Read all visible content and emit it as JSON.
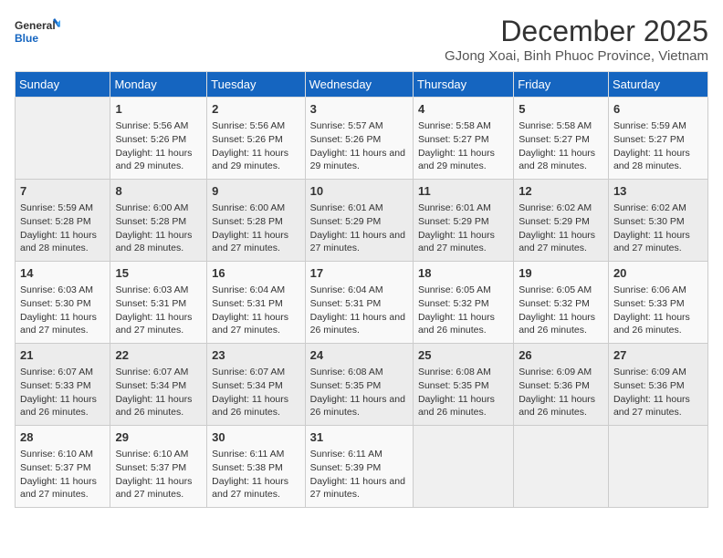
{
  "logo": {
    "line1": "General",
    "line2": "Blue"
  },
  "title": "December 2025",
  "location": "GJong Xoai, Binh Phuoc Province, Vietnam",
  "headers": [
    "Sunday",
    "Monday",
    "Tuesday",
    "Wednesday",
    "Thursday",
    "Friday",
    "Saturday"
  ],
  "weeks": [
    [
      {
        "day": "",
        "info": ""
      },
      {
        "day": "1",
        "info": "Sunrise: 5:56 AM\nSunset: 5:26 PM\nDaylight: 11 hours and 29 minutes."
      },
      {
        "day": "2",
        "info": "Sunrise: 5:56 AM\nSunset: 5:26 PM\nDaylight: 11 hours and 29 minutes."
      },
      {
        "day": "3",
        "info": "Sunrise: 5:57 AM\nSunset: 5:26 PM\nDaylight: 11 hours and 29 minutes."
      },
      {
        "day": "4",
        "info": "Sunrise: 5:58 AM\nSunset: 5:27 PM\nDaylight: 11 hours and 29 minutes."
      },
      {
        "day": "5",
        "info": "Sunrise: 5:58 AM\nSunset: 5:27 PM\nDaylight: 11 hours and 28 minutes."
      },
      {
        "day": "6",
        "info": "Sunrise: 5:59 AM\nSunset: 5:27 PM\nDaylight: 11 hours and 28 minutes."
      }
    ],
    [
      {
        "day": "7",
        "info": "Sunrise: 5:59 AM\nSunset: 5:28 PM\nDaylight: 11 hours and 28 minutes."
      },
      {
        "day": "8",
        "info": "Sunrise: 6:00 AM\nSunset: 5:28 PM\nDaylight: 11 hours and 28 minutes."
      },
      {
        "day": "9",
        "info": "Sunrise: 6:00 AM\nSunset: 5:28 PM\nDaylight: 11 hours and 27 minutes."
      },
      {
        "day": "10",
        "info": "Sunrise: 6:01 AM\nSunset: 5:29 PM\nDaylight: 11 hours and 27 minutes."
      },
      {
        "day": "11",
        "info": "Sunrise: 6:01 AM\nSunset: 5:29 PM\nDaylight: 11 hours and 27 minutes."
      },
      {
        "day": "12",
        "info": "Sunrise: 6:02 AM\nSunset: 5:29 PM\nDaylight: 11 hours and 27 minutes."
      },
      {
        "day": "13",
        "info": "Sunrise: 6:02 AM\nSunset: 5:30 PM\nDaylight: 11 hours and 27 minutes."
      }
    ],
    [
      {
        "day": "14",
        "info": "Sunrise: 6:03 AM\nSunset: 5:30 PM\nDaylight: 11 hours and 27 minutes."
      },
      {
        "day": "15",
        "info": "Sunrise: 6:03 AM\nSunset: 5:31 PM\nDaylight: 11 hours and 27 minutes."
      },
      {
        "day": "16",
        "info": "Sunrise: 6:04 AM\nSunset: 5:31 PM\nDaylight: 11 hours and 27 minutes."
      },
      {
        "day": "17",
        "info": "Sunrise: 6:04 AM\nSunset: 5:31 PM\nDaylight: 11 hours and 26 minutes."
      },
      {
        "day": "18",
        "info": "Sunrise: 6:05 AM\nSunset: 5:32 PM\nDaylight: 11 hours and 26 minutes."
      },
      {
        "day": "19",
        "info": "Sunrise: 6:05 AM\nSunset: 5:32 PM\nDaylight: 11 hours and 26 minutes."
      },
      {
        "day": "20",
        "info": "Sunrise: 6:06 AM\nSunset: 5:33 PM\nDaylight: 11 hours and 26 minutes."
      }
    ],
    [
      {
        "day": "21",
        "info": "Sunrise: 6:07 AM\nSunset: 5:33 PM\nDaylight: 11 hours and 26 minutes."
      },
      {
        "day": "22",
        "info": "Sunrise: 6:07 AM\nSunset: 5:34 PM\nDaylight: 11 hours and 26 minutes."
      },
      {
        "day": "23",
        "info": "Sunrise: 6:07 AM\nSunset: 5:34 PM\nDaylight: 11 hours and 26 minutes."
      },
      {
        "day": "24",
        "info": "Sunrise: 6:08 AM\nSunset: 5:35 PM\nDaylight: 11 hours and 26 minutes."
      },
      {
        "day": "25",
        "info": "Sunrise: 6:08 AM\nSunset: 5:35 PM\nDaylight: 11 hours and 26 minutes."
      },
      {
        "day": "26",
        "info": "Sunrise: 6:09 AM\nSunset: 5:36 PM\nDaylight: 11 hours and 26 minutes."
      },
      {
        "day": "27",
        "info": "Sunrise: 6:09 AM\nSunset: 5:36 PM\nDaylight: 11 hours and 27 minutes."
      }
    ],
    [
      {
        "day": "28",
        "info": "Sunrise: 6:10 AM\nSunset: 5:37 PM\nDaylight: 11 hours and 27 minutes."
      },
      {
        "day": "29",
        "info": "Sunrise: 6:10 AM\nSunset: 5:37 PM\nDaylight: 11 hours and 27 minutes."
      },
      {
        "day": "30",
        "info": "Sunrise: 6:11 AM\nSunset: 5:38 PM\nDaylight: 11 hours and 27 minutes."
      },
      {
        "day": "31",
        "info": "Sunrise: 6:11 AM\nSunset: 5:39 PM\nDaylight: 11 hours and 27 minutes."
      },
      {
        "day": "",
        "info": ""
      },
      {
        "day": "",
        "info": ""
      },
      {
        "day": "",
        "info": ""
      }
    ]
  ]
}
